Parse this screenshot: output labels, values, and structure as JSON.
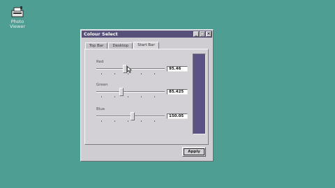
{
  "desktop": {
    "icon_name": "photo-viewer-icon",
    "icon_label_line1": "Photo",
    "icon_label_line2": "Viewer"
  },
  "window": {
    "title": "Colour Select",
    "title_buttons": [
      "_",
      "□",
      "×"
    ],
    "tabs": [
      {
        "label": "Top Bar",
        "active": false
      },
      {
        "label": "Desktop",
        "active": false
      },
      {
        "label": "Start Bar",
        "active": true
      }
    ],
    "sliders": [
      {
        "label": "Red",
        "value_text": "95.46",
        "value": 95.46,
        "max": 255
      },
      {
        "label": "Green",
        "value_text": "85.425",
        "value": 85.425,
        "max": 255
      },
      {
        "label": "Blue",
        "value_text": "150.05",
        "value": 150.05,
        "max": 255
      }
    ],
    "preview_color": "#5e5186",
    "apply_label": "Apply"
  },
  "colors": {
    "desktop": "#4f9e94",
    "titlebar": "#575078",
    "window_face": "#cfcdd2"
  }
}
